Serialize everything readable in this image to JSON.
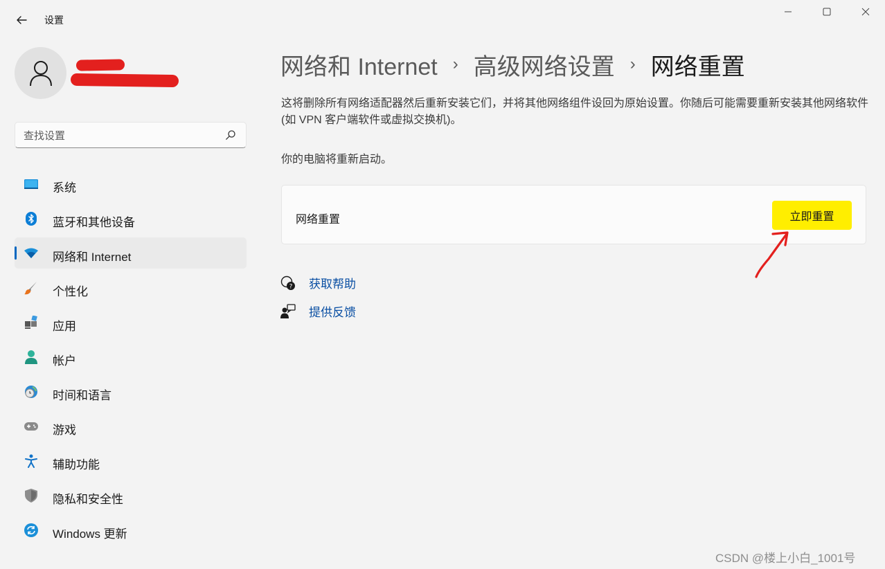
{
  "window": {
    "title": "设置"
  },
  "search": {
    "placeholder": "查找设置"
  },
  "sidebar": {
    "items": [
      {
        "label": "系统",
        "icon": "monitor-icon"
      },
      {
        "label": "蓝牙和其他设备",
        "icon": "bluetooth-icon"
      },
      {
        "label": "网络和 Internet",
        "icon": "wifi-icon",
        "active": true
      },
      {
        "label": "个性化",
        "icon": "brush-icon"
      },
      {
        "label": "应用",
        "icon": "apps-icon"
      },
      {
        "label": "帐户",
        "icon": "account-icon"
      },
      {
        "label": "时间和语言",
        "icon": "globe-clock-icon"
      },
      {
        "label": "游戏",
        "icon": "gamepad-icon"
      },
      {
        "label": "辅助功能",
        "icon": "accessibility-icon"
      },
      {
        "label": "隐私和安全性",
        "icon": "shield-icon"
      },
      {
        "label": "Windows 更新",
        "icon": "update-icon"
      }
    ]
  },
  "breadcrumb": {
    "items": [
      "网络和 Internet",
      "高级网络设置",
      "网络重置"
    ],
    "separator": "›"
  },
  "main": {
    "description": "这将删除所有网络适配器然后重新安装它们，并将其他网络组件设回为原始设置。你随后可能需要重新安装其他网络软件(如 VPN 客户端软件或虚拟交换机)。",
    "restart_note": "你的电脑将重新启动。",
    "card": {
      "label": "网络重置",
      "button": "立即重置"
    },
    "links": [
      {
        "label": "获取帮助",
        "icon": "help-icon"
      },
      {
        "label": "提供反馈",
        "icon": "feedback-icon"
      }
    ]
  },
  "watermark": "CSDN @楼上小白_1001号",
  "colors": {
    "accent": "#0067c0",
    "highlight": "#ffee00",
    "annotation": "#e3201e",
    "link": "#0a4fa3"
  }
}
